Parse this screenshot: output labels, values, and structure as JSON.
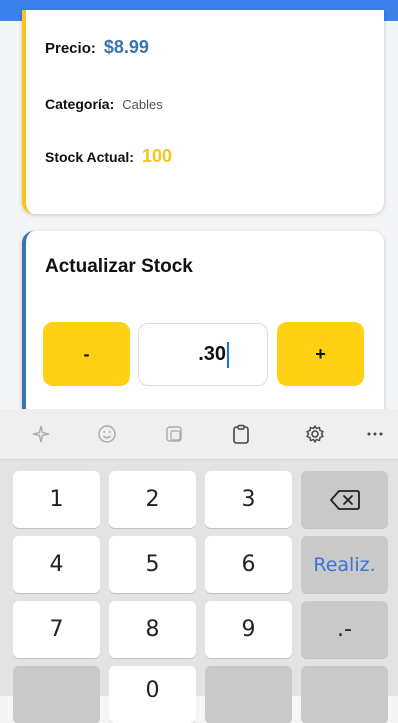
{
  "product": {
    "price_label": "Precio:",
    "price_value": "$8.99",
    "category_label": "Categoría:",
    "category_value": "Cables",
    "stock_label": "Stock Actual:",
    "stock_value": "100"
  },
  "update_stock": {
    "title": "Actualizar Stock",
    "decrement_label": "-",
    "increment_label": "+",
    "input_value": ".30"
  },
  "keyboard": {
    "toolbar": [
      "sparkle-icon",
      "emoji-icon",
      "sticker-icon",
      "clipboard-icon",
      "gear-icon",
      "more-icon"
    ],
    "keys": {
      "k1": "1",
      "k2": "2",
      "k3": "3",
      "k4": "4",
      "k5": "5",
      "k6": "6",
      "k7": "7",
      "k8": "8",
      "k9": "9",
      "k0": "0",
      "done": "Realiz.",
      "symbols": ".-"
    }
  }
}
